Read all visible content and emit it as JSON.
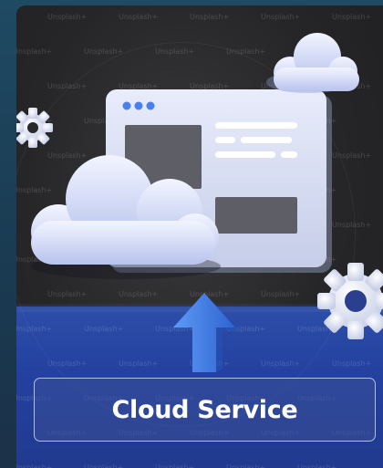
{
  "card": {
    "title": "Cloud Service",
    "watermark_text": "Unsplash+",
    "image_subject": "cloud-computing-illustration",
    "icons": [
      "cloud-icon",
      "browser-window-icon",
      "gear-icon",
      "upload-arrow-icon"
    ]
  },
  "colors": {
    "background": "#1e4157",
    "floor": "#2441a0",
    "window": "#d9def2",
    "accent_dots": "#4a7ff0",
    "cloud": "#e6ebff",
    "arrow": "#3f7fe8",
    "label_border": "#e1e8ff"
  }
}
